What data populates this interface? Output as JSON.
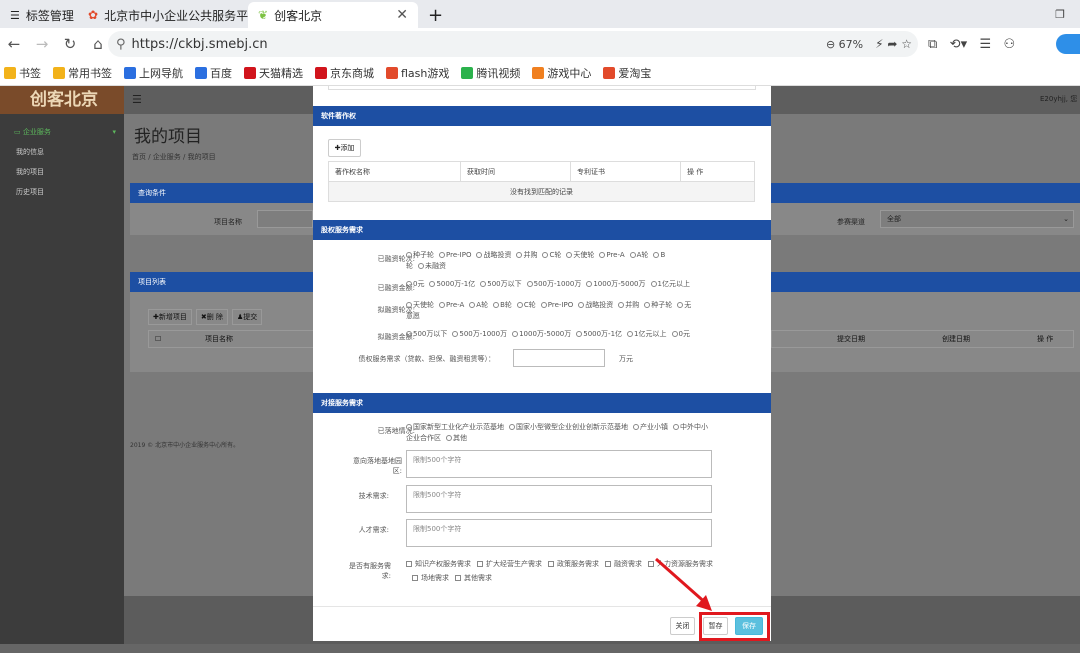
{
  "browser": {
    "tabs": [
      {
        "label": "标签管理"
      },
      {
        "label": "北京市中小企业公共服务平台"
      },
      {
        "label": "创客北京"
      }
    ],
    "url": "https://ckbj.smebj.cn",
    "zoom": "67%",
    "bookmarks": [
      {
        "label": "书签",
        "color": "#f2b21a"
      },
      {
        "label": "常用书签",
        "color": "#f2b21a"
      },
      {
        "label": "上网导航",
        "color": "#2b6fe0"
      },
      {
        "label": "百度",
        "color": "#2b6fe0"
      },
      {
        "label": "天猫精选",
        "color": "#d1141c"
      },
      {
        "label": "京东商城",
        "color": "#d1141c"
      },
      {
        "label": "flash游戏",
        "color": "#e24a2b"
      },
      {
        "label": "腾讯视频",
        "color": "#2bb24c"
      },
      {
        "label": "游戏中心",
        "color": "#f08020"
      },
      {
        "label": "爱淘宝",
        "color": "#e24a2b"
      }
    ]
  },
  "app": {
    "logo": "创客北京",
    "user": "E20yhjj, 您",
    "sidebar": [
      {
        "label": "企业服务"
      },
      {
        "label": "我的信息"
      },
      {
        "label": "我的项目"
      },
      {
        "label": "历史项目"
      }
    ],
    "page_title": "我的项目",
    "breadcrumb": "首页  /  企业服务  /  我的项目",
    "query_title": "查询条件",
    "project_name_label": "项目名称",
    "channel_label": "参赛渠道",
    "channel_value": "全部",
    "list_title": "项目列表",
    "list_buttons": [
      "新增项目",
      "删 除",
      "提交"
    ],
    "list_columns": [
      "项目名称",
      "提交日期",
      "创建日期",
      "操 作"
    ],
    "footer": "2019 © 北京市中小企业服务中心所有。"
  },
  "modal": {
    "software": {
      "title": "软件著作权",
      "add_label": "添加",
      "columns": [
        "著作权名称",
        "获取时间",
        "专利证书",
        "操 作"
      ],
      "empty": "没有找到匹配的记录"
    },
    "equity": {
      "title": "股权服务需求",
      "rounds_label": "已融资轮次:",
      "rounds_line1": [
        "种子轮",
        "Pre-IPO",
        "战略投资",
        "并购",
        "C轮",
        "天使轮",
        "Pre-A",
        "A轮",
        "B"
      ],
      "rounds_line2": [
        "轮",
        "未融资"
      ],
      "amount_label": "已融资金额:",
      "amount_opts": [
        "0元",
        "5000万-1亿",
        "500万以下",
        "500万-1000万",
        "1000万-5000万",
        "1亿元以上"
      ],
      "plan_label": "拟融资轮次:",
      "plan_line1": [
        "天使轮",
        "Pre-A",
        "A轮",
        "B轮",
        "C轮",
        "Pre-IPO",
        "战略投资",
        "并购",
        "种子轮",
        "无"
      ],
      "plan_line2": "意愿",
      "plan_amount_label": "拟融资金额:",
      "plan_amount_opts": [
        "500万以下",
        "500万-1000万",
        "1000万-5000万",
        "5000万-1亿",
        "1亿元以上",
        "0元"
      ],
      "debt_label": "债权服务需求（贷款、担保、融资租赁等）：",
      "debt_unit": "万元"
    },
    "docking": {
      "title": "对接服务需求",
      "base_label": "已落地情况:",
      "base_line1": [
        "国家新型工业化产业示范基地",
        "国家小型微型企业创业创新示范基地",
        "产业小镇",
        "中外中小"
      ],
      "base_line2": "企业合作区",
      "base_other": "其他",
      "intent_label_1": "意向落地基地园",
      "intent_label_2": "区:",
      "placeholder": "限制500个字符",
      "tech_label": "技术需求:",
      "talent_label": "人才需求:",
      "service_label_1": "是否有服务需",
      "service_label_2": "求:",
      "service_line1": [
        "知识产权服务需求",
        "扩大经营生产需求",
        "政策服务需求",
        "融资需求",
        "人力资源服务需求"
      ],
      "service_line2": [
        "场地需求",
        "其他需求"
      ]
    },
    "buttons": {
      "close": "关闭",
      "draft": "暂存",
      "save": "保存"
    }
  },
  "colors": {
    "section_header": "#1d4fa3",
    "save_button": "#5bc0de",
    "highlight": "#e0181e"
  }
}
